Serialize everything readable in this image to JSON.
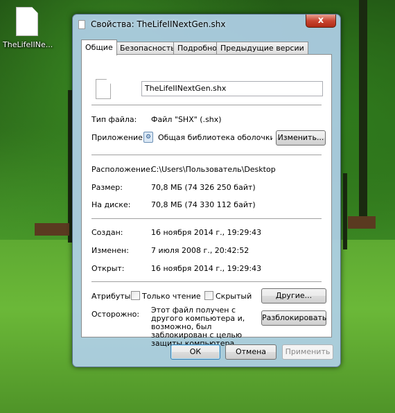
{
  "desktop": {
    "icon_label": "TheLifeIINe..."
  },
  "window": {
    "title": "Свойства: TheLifeIINextGen.shx",
    "close_glyph": "x"
  },
  "tabs": [
    {
      "label": "Общие",
      "active": true
    },
    {
      "label": "Безопасность",
      "active": false
    },
    {
      "label": "Подробно",
      "active": false
    },
    {
      "label": "Предыдущие версии",
      "active": false
    }
  ],
  "general": {
    "filename": "TheLifeIINextGen.shx",
    "file_type_label": "Тип файла:",
    "file_type_value": "Файл \"SHX\" (.shx)",
    "app_label": "Приложение:",
    "app_value": "Общая библиотека оболочки Wi",
    "change_button": "Изменить...",
    "location_label": "Расположение:",
    "location_value": "C:\\Users\\Пользователь\\Desktop",
    "size_label": "Размер:",
    "size_value": "70,8 МБ (74 326 250 байт)",
    "ondisk_label": "На диске:",
    "ondisk_value": "70,8 МБ (74 330 112 байт)",
    "created_label": "Создан:",
    "created_value": "16 ноября 2014 г., 19:29:43",
    "modified_label": "Изменен:",
    "modified_value": "7 июля 2008 г., 20:42:52",
    "accessed_label": "Открыт:",
    "accessed_value": "16 ноября 2014 г., 19:29:43",
    "attributes_label": "Атрибуты:",
    "readonly_label": "Только чтение",
    "readonly_checked": false,
    "hidden_label": "Скрытый",
    "hidden_checked": false,
    "other_button": "Другие...",
    "caution_label": "Осторожно:",
    "caution_text": "Этот файл получен с другого компьютера и, возможно, был заблокирован с целью защиты компьютера.",
    "unblock_button": "Разблокировать"
  },
  "footer": {
    "ok": "ОК",
    "cancel": "Отмена",
    "apply": "Применить"
  }
}
